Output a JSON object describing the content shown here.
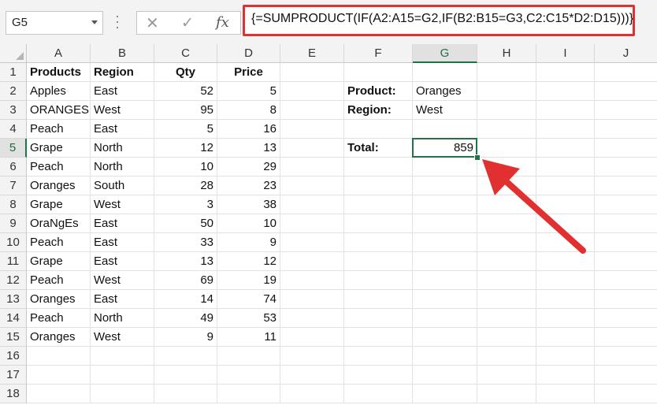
{
  "name_box": "G5",
  "formula_bar": {
    "cancel_icon": "cancel-icon",
    "enter_icon": "check-icon",
    "fx_label": "fx",
    "formula": "{=SUMPRODUCT(IF(A2:A15=G2,IF(B2:B15=G3,C2:C15*D2:D15)))}"
  },
  "columns": [
    "A",
    "B",
    "C",
    "D",
    "E",
    "F",
    "G",
    "H",
    "I",
    "J"
  ],
  "rows": [
    "1",
    "2",
    "3",
    "4",
    "5",
    "6",
    "7",
    "8",
    "9",
    "10",
    "11",
    "12",
    "13",
    "14",
    "15",
    "16",
    "17",
    "18"
  ],
  "headers": {
    "A": "Products",
    "B": "Region",
    "C": "Qty",
    "D": "Price"
  },
  "data": [
    {
      "A": "Apples",
      "B": "East",
      "C": "52",
      "D": "5"
    },
    {
      "A": "ORANGES",
      "B": "West",
      "C": "95",
      "D": "8"
    },
    {
      "A": "Peach",
      "B": "East",
      "C": "5",
      "D": "16"
    },
    {
      "A": "Grape",
      "B": "North",
      "C": "12",
      "D": "13"
    },
    {
      "A": "Peach",
      "B": "North",
      "C": "10",
      "D": "29"
    },
    {
      "A": "Oranges",
      "B": "South",
      "C": "28",
      "D": "23"
    },
    {
      "A": "Grape",
      "B": "West",
      "C": "3",
      "D": "38"
    },
    {
      "A": "OraNgEs",
      "B": "East",
      "C": "50",
      "D": "10"
    },
    {
      "A": "Peach",
      "B": "East",
      "C": "33",
      "D": "9"
    },
    {
      "A": "Grape",
      "B": "East",
      "C": "13",
      "D": "12"
    },
    {
      "A": "Peach",
      "B": "West",
      "C": "69",
      "D": "19"
    },
    {
      "A": "Oranges",
      "B": "East",
      "C": "14",
      "D": "74"
    },
    {
      "A": "Peach",
      "B": "North",
      "C": "49",
      "D": "53"
    },
    {
      "A": "Oranges",
      "B": "West",
      "C": "9",
      "D": "11"
    }
  ],
  "criteria": {
    "product_label": "Product:",
    "product_value": "Oranges",
    "region_label": "Region:",
    "region_value": "West",
    "total_label": "Total:",
    "total_value": "859"
  },
  "colors": {
    "accent": "#217346",
    "highlight": "#e03030"
  }
}
